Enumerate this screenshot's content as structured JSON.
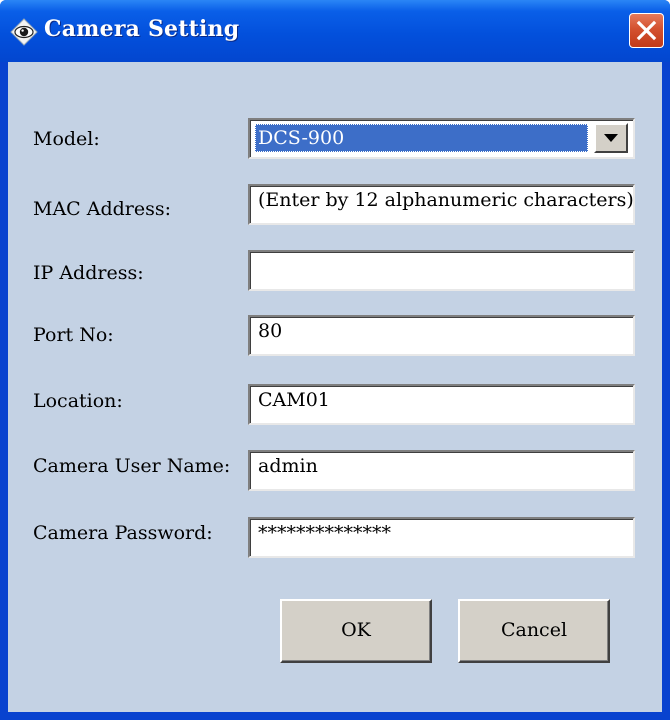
{
  "window": {
    "title": "Camera Setting",
    "title_icon": "camera-eye-icon",
    "close_icon": "close-icon"
  },
  "form": {
    "model": {
      "label": "Model:",
      "value": "DCS-900",
      "dropdown_icon": "chevron-down-icon"
    },
    "mac": {
      "label": "MAC Address:",
      "value": "(Enter by 12 alphanumeric characters)"
    },
    "ip": {
      "label": "IP Address:",
      "value": ""
    },
    "port": {
      "label": "Port No:",
      "value": "80"
    },
    "location": {
      "label": "Location:",
      "value": "CAM01"
    },
    "username": {
      "label": "Camera User Name:",
      "value": "admin"
    },
    "password": {
      "label": "Camera Password:",
      "value": "**************"
    }
  },
  "buttons": {
    "ok": "OK",
    "cancel": "Cancel"
  },
  "colors": {
    "titlebar": "#0350dc",
    "client_background": "#c4d2e4",
    "selection": "#3d6ec8",
    "close_button": "#d4512f"
  }
}
